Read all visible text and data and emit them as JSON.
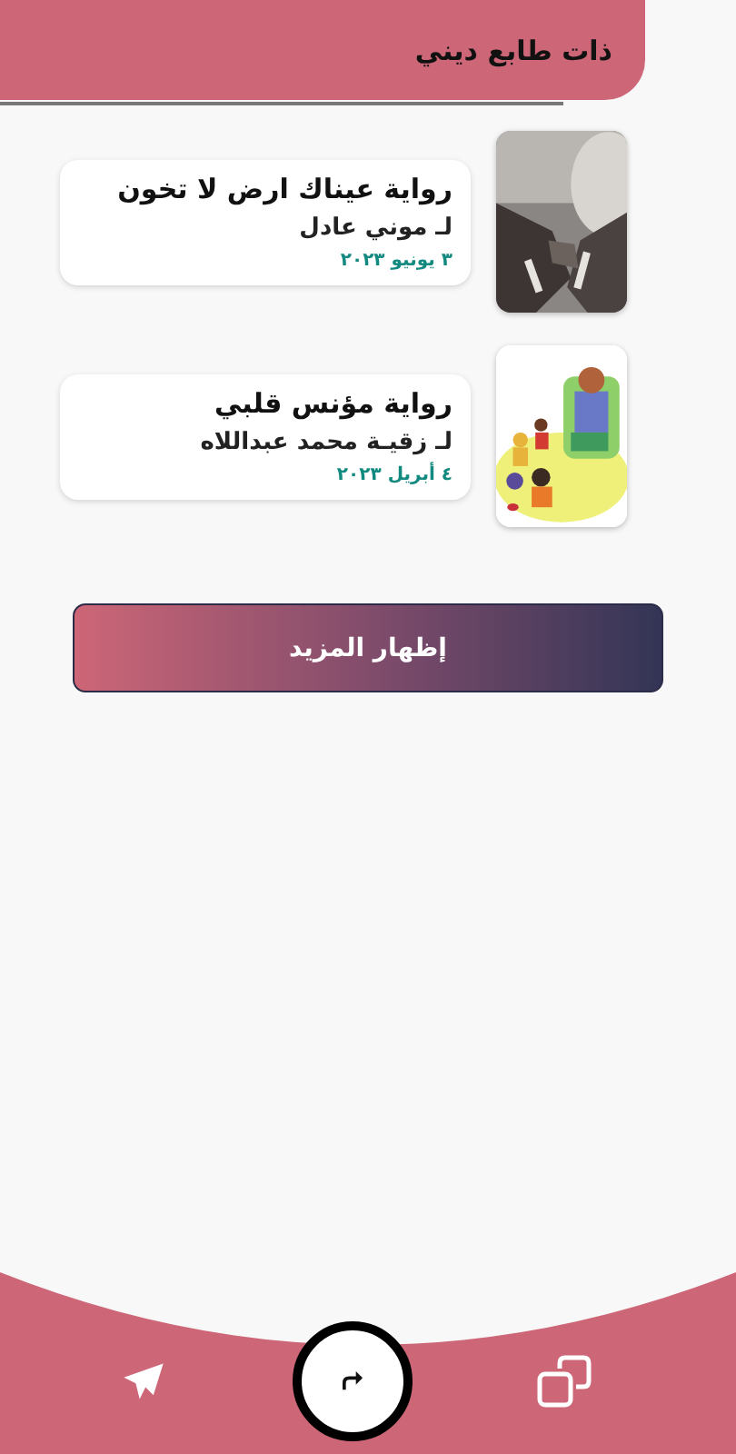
{
  "header": {
    "title": "ذات طابع ديني"
  },
  "books": [
    {
      "title": "رواية عيناك ارض لا تخون",
      "author": "لـ موني عادل",
      "date": "٣ يونيو ٢٠٢٣"
    },
    {
      "title": "رواية مؤنس قلبي",
      "author": "لـ زقيـة محمد عبداللاه",
      "date": "٤ أبريل ٢٠٢٣"
    }
  ],
  "more_button": {
    "label": "إظهار المزيد"
  },
  "bottom_bar": {
    "buttons": [
      {
        "kind": "send"
      },
      {
        "kind": "share"
      },
      {
        "kind": "copy"
      }
    ]
  }
}
